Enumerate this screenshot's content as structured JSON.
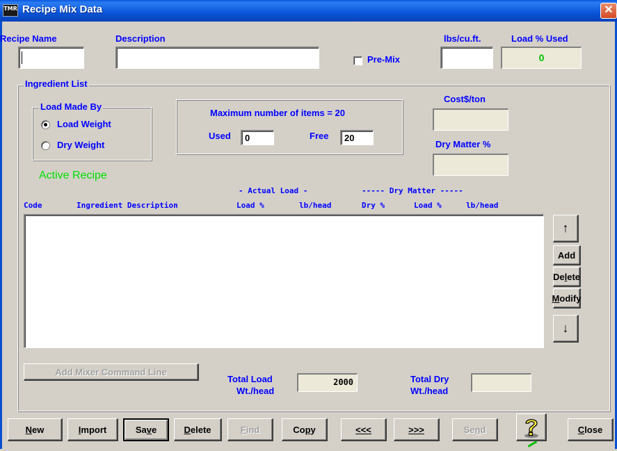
{
  "window": {
    "title": "Recipe Mix Data",
    "icon_text": "TMR",
    "icon": "tmr-app-icon"
  },
  "header": {
    "recipe_name_label": "Recipe Name",
    "recipe_name_value": "",
    "description_label": "Description",
    "description_value": "",
    "premix_label": "Pre-Mix",
    "premix_checked": false,
    "lbs_cuft_label": "lbs/cu.ft.",
    "lbs_cuft_value": "",
    "load_used_label": "Load % Used",
    "load_used_value": "0"
  },
  "ingredient_list": {
    "group_label": "Ingredient List",
    "load_made_by": {
      "label": "Load Made By",
      "options": [
        "Load Weight",
        "Dry Weight"
      ],
      "selected": "Load Weight"
    },
    "items_box": {
      "max_text": "Maximum number of items = 20",
      "used_label": "Used",
      "used_value": "0",
      "free_label": "Free",
      "free_value": "20"
    },
    "cost_label": "Cost$/ton",
    "cost_value": "",
    "dry_matter_label": "Dry Matter %",
    "dry_matter_value": "",
    "status_text": "Active Recipe",
    "status_color": "#00e000",
    "header_groups": {
      "actual_load": "- Actual Load -",
      "dry_matter": "----- Dry Matter -----"
    },
    "columns": [
      "Code",
      "Ingredient Description",
      "Load %",
      "lb/head",
      "Dry %",
      "Load %",
      "lb/head"
    ],
    "rows": []
  },
  "side_buttons": {
    "up_icon": "arrow-up-icon",
    "add": "Add",
    "delete": "Delete",
    "modify": "Modify",
    "down_icon": "arrow-down-icon"
  },
  "footer": {
    "add_mixer_command": "Add Mixer Command Line",
    "total_load_label_1": "Total Load",
    "total_load_label_2": "Wt./head",
    "total_load_value": "2000",
    "total_dry_label_1": "Total Dry",
    "total_dry_label_2": "Wt./head",
    "total_dry_value": ""
  },
  "toolbar": {
    "new": "New",
    "import": "Import",
    "save": "Save",
    "delete": "Delete",
    "find": "Find",
    "copy": "Copy",
    "prev": "<<<",
    "next": ">>>",
    "send": "Send",
    "help_icon": "help-question-icon",
    "close": "Close"
  },
  "colors": {
    "label_blue": "#0000ff",
    "titlebar": "#0a55d8",
    "face": "#d4d0c8"
  }
}
